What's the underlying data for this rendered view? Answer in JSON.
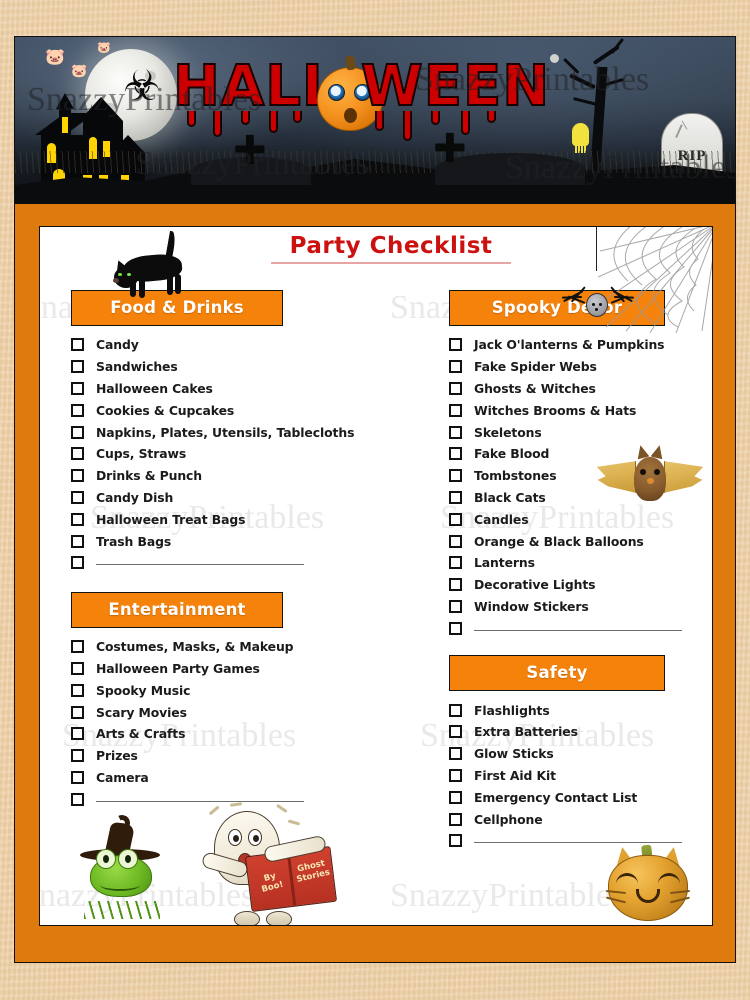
{
  "page": {
    "title": "Party Checklist",
    "watermark": "SnazzyPrintables",
    "banner_word_left": "HALL",
    "banner_word_right": "WEEN",
    "gravestone_text": "RIP",
    "book_title_line1": "By Boo!",
    "book_title_line2": "Ghost Stories"
  },
  "colors": {
    "frame_orange": "#de7a0e",
    "header_orange": "#f5820b",
    "title_red": "#cc1111",
    "page_background": "#eccfa7",
    "checkbox_border": "#111111"
  },
  "columns": {
    "left": [
      {
        "heading": "Food & Drinks",
        "items": [
          "Candy",
          "Sandwiches",
          "Halloween Cakes",
          "Cookies & Cupcakes",
          "Napkins, Plates, Utensils, Tablecloths",
          "Cups, Straws",
          "Drinks & Punch",
          "Candy Dish",
          "Halloween Treat Bags",
          "Trash Bags"
        ],
        "blank_lines": 1
      },
      {
        "heading": "Entertainment",
        "items": [
          "Costumes, Masks, & Makeup",
          "Halloween Party Games",
          "Spooky Music",
          "Scary Movies",
          "Arts & Crafts",
          "Prizes",
          "Camera"
        ],
        "blank_lines": 1
      }
    ],
    "right": [
      {
        "heading": "Spooky Decor",
        "items": [
          "Jack O'lanterns & Pumpkins",
          "Fake Spider Webs",
          "Ghosts & Witches",
          "Witches Brooms & Hats",
          "Skeletons",
          "Fake Blood",
          "Tombstones",
          "Black Cats",
          "Candles",
          "Orange & Black Balloons",
          "Lanterns",
          "Decorative Lights",
          "Window Stickers"
        ],
        "blank_lines": 1
      },
      {
        "heading": "Safety",
        "items": [
          "Flashlights",
          "Extra Batteries",
          "Glow Sticks",
          "First Aid Kit",
          "Emergency Contact List",
          "Cellphone"
        ],
        "blank_lines": 1
      }
    ]
  }
}
